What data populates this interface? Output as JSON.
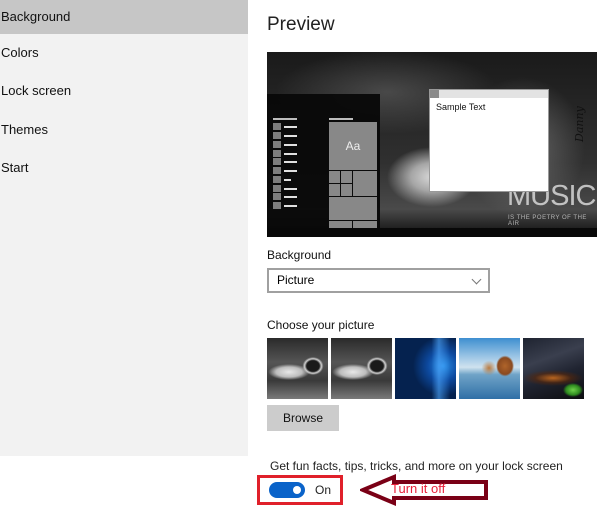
{
  "sidebar": {
    "items": [
      {
        "label": "Background",
        "selected": true
      },
      {
        "label": "Colors",
        "selected": false
      },
      {
        "label": "Lock screen",
        "selected": false
      },
      {
        "label": "Themes",
        "selected": false
      },
      {
        "label": "Start",
        "selected": false
      }
    ]
  },
  "main": {
    "title": "Preview",
    "preview": {
      "tile_label": "Aa",
      "sample_text": "Sample Text",
      "wallpaper_title": "MUSIC",
      "wallpaper_subtitle": "IS THE POETRY OF THE AIR",
      "wallpaper_signature": "Danny"
    },
    "background_label": "Background",
    "background_dropdown": {
      "selected": "Picture"
    },
    "choose_picture_label": "Choose your picture",
    "pictures": [
      {
        "name": "earphones-grayscale-1"
      },
      {
        "name": "earphones-grayscale-2"
      },
      {
        "name": "windows-10-blue"
      },
      {
        "name": "beach-rocks"
      },
      {
        "name": "night-sky-tent"
      }
    ],
    "browse_label": "Browse",
    "tips_label": "Get fun facts, tips, tricks, and more on your lock screen",
    "tips_toggle": {
      "state": "On",
      "on": true,
      "color": "#0a63c9"
    }
  },
  "annotation": {
    "text": "Turn it off",
    "text_color": "#e8203a",
    "arrow_color": "#7a0016",
    "box_color": "#e0202a"
  }
}
